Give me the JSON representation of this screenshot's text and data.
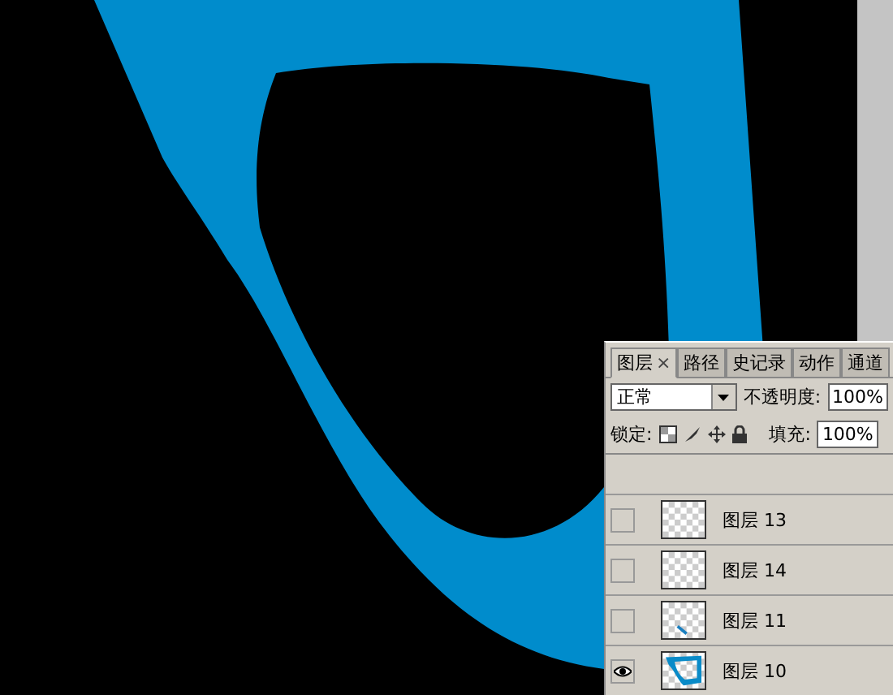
{
  "tabs": [
    {
      "label": "图层",
      "selected": true,
      "close_mark": "×"
    },
    {
      "label": "路径",
      "selected": false
    },
    {
      "label": "史记录",
      "selected": false
    },
    {
      "label": "动作",
      "selected": false
    },
    {
      "label": "通道",
      "selected": false
    }
  ],
  "blend_mode": "正常",
  "opacity": {
    "label": "不透明度:",
    "value": "100%"
  },
  "lock": {
    "label": "锁定:"
  },
  "fill": {
    "label": "填充:",
    "value": "100%"
  },
  "layers": [
    {
      "name": "图层 13",
      "visible": false,
      "kind": "empty"
    },
    {
      "name": "图层 14",
      "visible": false,
      "kind": "empty"
    },
    {
      "name": "图层 11",
      "visible": false,
      "kind": "stroke"
    },
    {
      "name": "图层 10",
      "visible": true,
      "kind": "frame"
    }
  ]
}
